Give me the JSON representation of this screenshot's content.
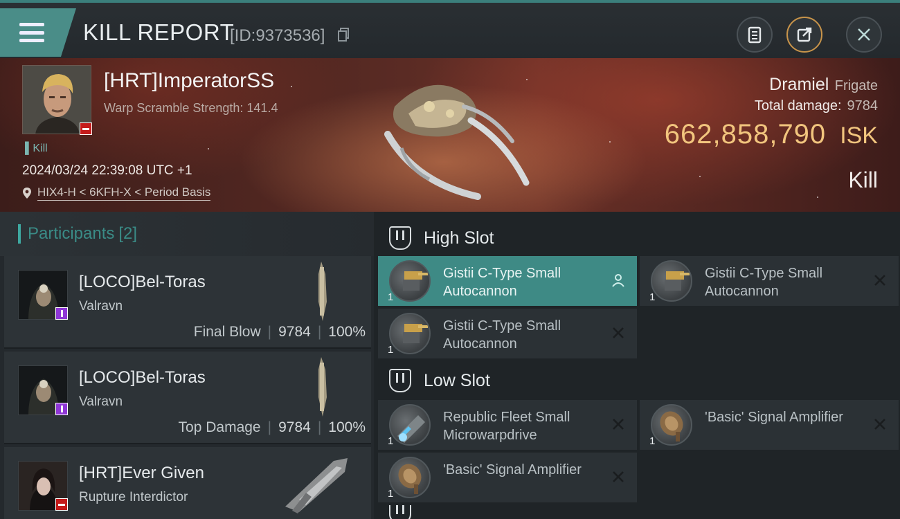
{
  "header": {
    "title": "KILL REPORT",
    "report_id": "[ID:9373536]"
  },
  "victim": {
    "name": "[HRT]ImperatorSS",
    "warp_scramble": "Warp Scramble Strength: 141.4",
    "kill_tag": "Kill",
    "datetime": "2024/03/24 22:39:08 UTC +1",
    "location": "HIX4-H < 6KFH-X < Period Basis",
    "ship_name": "Dramiel",
    "ship_class": "Frigate",
    "total_damage_label": "Total damage:",
    "total_damage": "9784",
    "isk_value": "662,858,790",
    "isk_unit": "ISK",
    "result": "Kill"
  },
  "participants": {
    "label": "Participants",
    "count": "[2]",
    "items": [
      {
        "name": "[LOCO]Bel-Toras",
        "ship": "Valravn",
        "role": "Final Blow",
        "damage": "9784",
        "percent": "100%"
      },
      {
        "name": "[LOCO]Bel-Toras",
        "ship": "Valravn",
        "role": "Top Damage",
        "damage": "9784",
        "percent": "100%"
      },
      {
        "name": "[HRT]Ever Given",
        "ship": "Rupture Interdictor"
      }
    ]
  },
  "fitting": {
    "high_slot": {
      "title": "High Slot",
      "modules": [
        {
          "name": "Gistii C-Type Small Autocannon",
          "qty": "1",
          "status": "dropped"
        },
        {
          "name": "Gistii C-Type Small Autocannon",
          "qty": "1",
          "status": "destroyed"
        },
        {
          "name": "Gistii C-Type Small Autocannon",
          "qty": "1",
          "status": "destroyed"
        }
      ]
    },
    "low_slot": {
      "title": "Low Slot",
      "modules": [
        {
          "name": "Republic Fleet Small Microwarpdrive",
          "qty": "1",
          "status": "destroyed"
        },
        {
          "name": "'Basic' Signal Amplifier",
          "qty": "1",
          "status": "destroyed"
        },
        {
          "name": "'Basic' Signal Amplifier",
          "qty": "1",
          "status": "destroyed"
        }
      ]
    }
  },
  "colors": {
    "accent_teal": "#3e8a85",
    "isk_gold": "#f2c57e",
    "badge_red": "#c41b1b",
    "badge_purple": "#8f37d6"
  },
  "icons": [
    "menu-icon",
    "copy-icon",
    "clipboard-icon",
    "share-icon",
    "close-icon",
    "location-pin-icon",
    "slot-icon",
    "person-icon",
    "x-icon"
  ]
}
